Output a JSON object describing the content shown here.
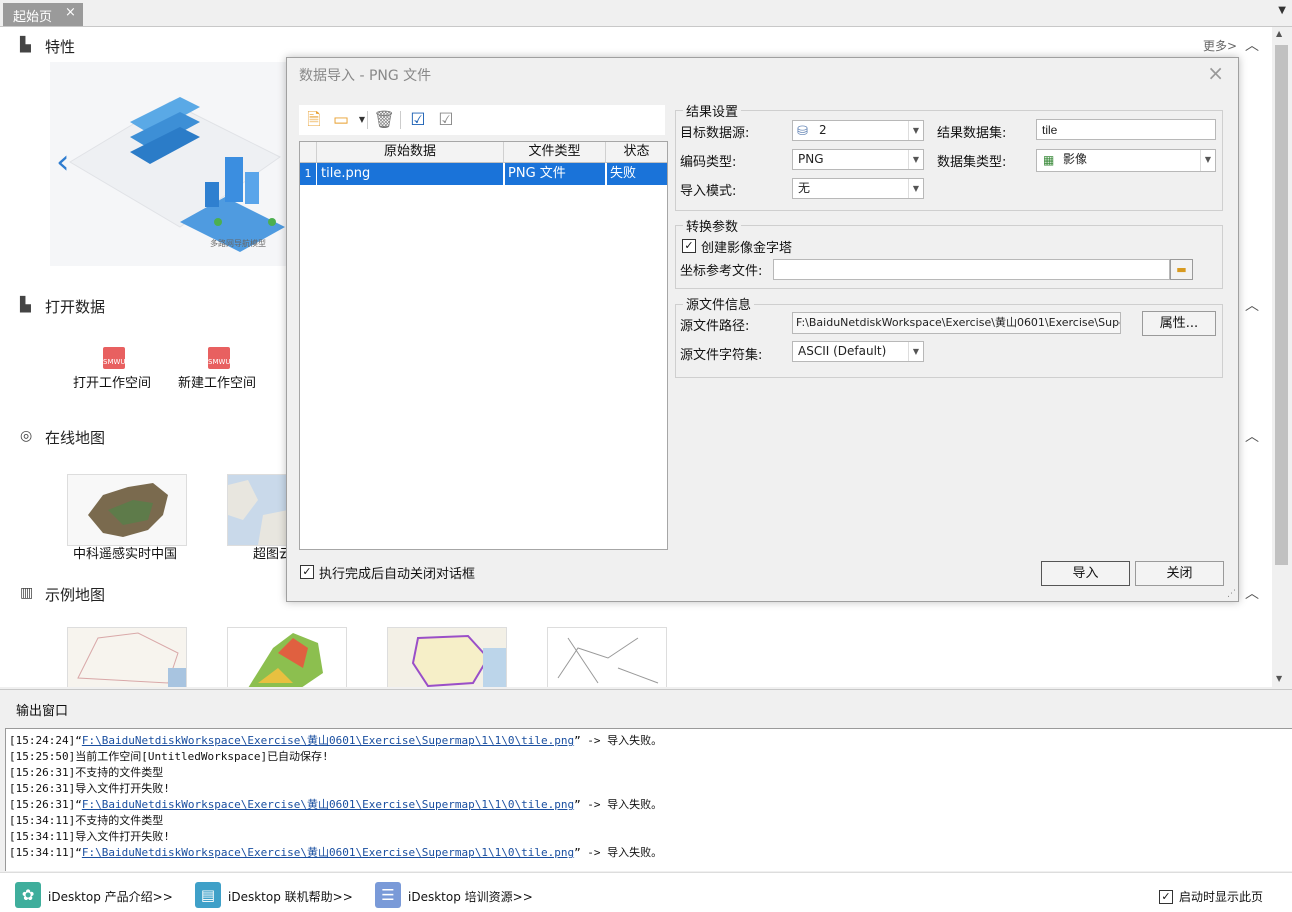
{
  "tabbar": {
    "tab_label": "起始页",
    "tab_close": "×"
  },
  "startpage": {
    "more_link": "更多>",
    "features": {
      "title": "特性",
      "diagram_caption": "多路网导航模型"
    },
    "open_data": {
      "title": "打开数据",
      "items": [
        "打开工作空间",
        "新建工作空间"
      ]
    },
    "online_maps": {
      "title": "在线地图",
      "items": [
        "中科遥感实时中国",
        "超图云"
      ]
    },
    "sample_maps": {
      "title": "示例地图"
    }
  },
  "dialog": {
    "title": "数据导入 - PNG 文件",
    "table": {
      "headers": [
        "原始数据",
        "文件类型",
        "状态"
      ],
      "rows": [
        {
          "index": "1",
          "name": "tile.png",
          "type": "PNG 文件",
          "status": "失败"
        }
      ]
    },
    "auto_close_label": "执行完成后自动关闭对话框",
    "result_settings": {
      "title": "结果设置",
      "target_datasource_label": "目标数据源:",
      "target_datasource_value": "2",
      "result_dataset_label": "结果数据集:",
      "result_dataset_value": "tile",
      "encoding_label": "编码类型:",
      "encoding_value": "PNG",
      "dataset_type_label": "数据集类型:",
      "dataset_type_value": "影像",
      "import_mode_label": "导入模式:",
      "import_mode_value": "无"
    },
    "conversion": {
      "title": "转换参数",
      "pyramid_label": "创建影像金字塔",
      "coord_ref_label": "坐标参考文件:",
      "coord_ref_value": ""
    },
    "source_info": {
      "title": "源文件信息",
      "path_label": "源文件路径:",
      "path_value": "F:\\BaiduNetdiskWorkspace\\Exercise\\黄山0601\\Exercise\\Superm",
      "properties_button": "属性...",
      "charset_label": "源文件字符集:",
      "charset_value": "ASCII (Default)"
    },
    "import_button": "导入",
    "close_button": "关闭"
  },
  "output": {
    "title": "输出窗口",
    "lines": [
      {
        "ts": "[15:24:24]",
        "pre": "“",
        "link": "F:\\BaiduNetdiskWorkspace\\Exercise\\黄山0601\\Exercise\\Supermap\\1\\1\\0\\tile.png",
        "post": "”      -> 导入失败。"
      },
      {
        "ts": "[15:25:50]",
        "pre": "",
        "link": "",
        "post": "当前工作空间[UntitledWorkspace]已自动保存!"
      },
      {
        "ts": "[15:26:31]",
        "pre": "",
        "link": "",
        "post": "不支持的文件类型"
      },
      {
        "ts": "[15:26:31]",
        "pre": "",
        "link": "",
        "post": "导入文件打开失败!"
      },
      {
        "ts": "[15:26:31]",
        "pre": "“",
        "link": "F:\\BaiduNetdiskWorkspace\\Exercise\\黄山0601\\Exercise\\Supermap\\1\\1\\0\\tile.png",
        "post": "”      -> 导入失败。"
      },
      {
        "ts": "[15:34:11]",
        "pre": "",
        "link": "",
        "post": "不支持的文件类型"
      },
      {
        "ts": "[15:34:11]",
        "pre": "",
        "link": "",
        "post": "导入文件打开失败!"
      },
      {
        "ts": "[15:34:11]",
        "pre": "“",
        "link": "F:\\BaiduNetdiskWorkspace\\Exercise\\黄山0601\\Exercise\\Supermap\\1\\1\\0\\tile.png",
        "post": "”      -> 导入失败。"
      }
    ]
  },
  "bottombar": {
    "product_intro": "iDesktop 产品介绍>>",
    "online_help": "iDesktop 联机帮助>>",
    "training": "iDesktop 培训资源>>",
    "show_on_start": "启动时显示此页"
  },
  "colors": {
    "selection": "#1a73d9",
    "link": "#1a4fa0",
    "tab_bg": "#9a9a9a"
  }
}
